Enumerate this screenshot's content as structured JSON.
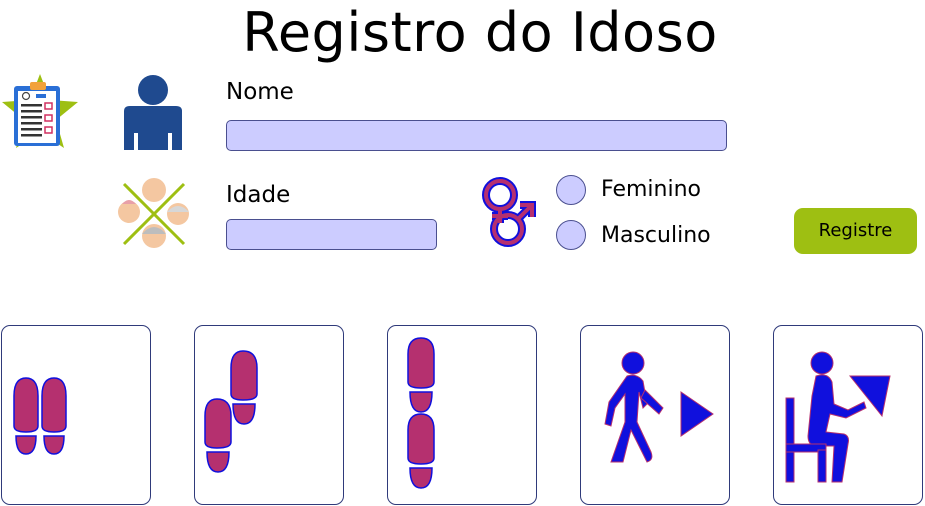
{
  "title": "Registro do Idoso",
  "form": {
    "name_label": "Nome",
    "name_value": "",
    "age_label": "Idade",
    "age_value": "",
    "gender_options": [
      "Feminino",
      "Masculino"
    ],
    "submit_label": "Registre"
  },
  "icons": {
    "clipboard": "clipboard-icon",
    "user": "user-icon",
    "ages": "age-group-icon",
    "gender": "gender-symbol-icon"
  },
  "tests": [
    {
      "icon": "feet-together-icon"
    },
    {
      "icon": "semi-tandem-feet-icon"
    },
    {
      "icon": "tandem-feet-icon"
    },
    {
      "icon": "walking-person-play-icon"
    },
    {
      "icon": "sit-to-stand-icon"
    }
  ],
  "colors": {
    "field": "#ccccff",
    "button": "#9ebf12",
    "footprint": "#b5306f",
    "figure": "#1010dd"
  }
}
